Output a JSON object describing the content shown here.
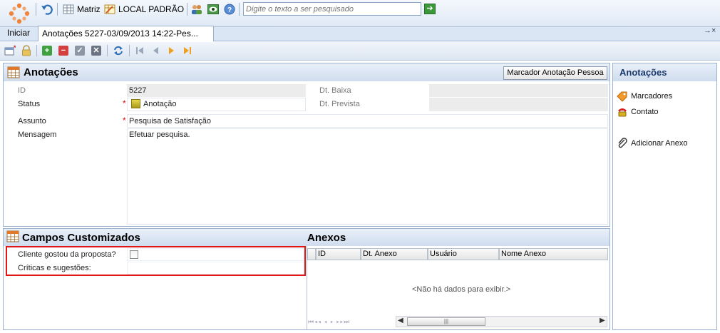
{
  "topbar": {
    "company_label": "Matriz",
    "location_label": "LOCAL PADRÃO",
    "search_placeholder": "Digite o texto a ser pesquisado"
  },
  "tabs": [
    {
      "label": "Iniciar"
    },
    {
      "label": "Anotações 5227-03/09/2013 14:22-Pes..."
    }
  ],
  "tab_overflow": "→×",
  "form": {
    "title": "Anotações",
    "marker_button": "Marcador Anotação Pessoa",
    "id_label": "ID",
    "id_value": "5227",
    "status_label": "Status",
    "status_value": "Anotação",
    "dt_baixa_label": "Dt. Baixa",
    "dt_prevista_label": "Dt. Prevista",
    "assunto_label": "Assunto",
    "assunto_value": "Pesquisa de Satisfação",
    "mensagem_label": "Mensagem",
    "mensagem_value": "Efetuar pesquisa.",
    "required_mark": "*"
  },
  "custom_fields": {
    "title": "Campos Customizados",
    "rows": [
      {
        "label": "Cliente gostou da proposta?"
      },
      {
        "label": "Críticas e sugestões:"
      }
    ]
  },
  "attachments": {
    "title": "Anexos",
    "columns": [
      "ID",
      "Dt. Anexo",
      "Usuário",
      "Nome Anexo"
    ],
    "empty_text": "<Não há dados para exibir.>"
  },
  "sidebar": {
    "title": "Anotações",
    "items": [
      {
        "label": "Marcadores"
      },
      {
        "label": "Contato"
      },
      {
        "label": "Adicionar Anexo"
      }
    ]
  },
  "colors": {
    "highlight_border": "#e01515",
    "header_gradient_top": "#e9f0f9",
    "header_gradient_bottom": "#cfdcee",
    "sidebar_title": "#1b3a6b"
  }
}
